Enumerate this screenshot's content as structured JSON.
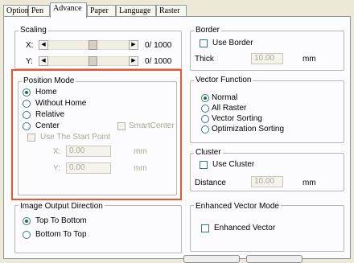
{
  "tabs": [
    "Option",
    "Pen",
    "Advance",
    "Paper",
    "Language",
    "Raster"
  ],
  "active_tab": "Advance",
  "scaling": {
    "title": "Scaling",
    "x_label": "X:",
    "y_label": "Y:",
    "x_value": "0/ 1000",
    "y_value": "0/ 1000"
  },
  "position_mode": {
    "title": "Position Mode",
    "options": [
      "Home",
      "Without Home",
      "Relative",
      "Center"
    ],
    "selected": "Home",
    "smart_center": "SmartCenter",
    "use_start_point": "Use The Start Point",
    "x_label": "X:",
    "y_label": "Y:",
    "x_value": "0.00",
    "y_value": "0.00",
    "unit": "mm"
  },
  "image_output": {
    "title": "Image Output Direction",
    "options": [
      "Top To Bottom",
      "Bottom To Top"
    ],
    "selected": "Top To Bottom"
  },
  "border": {
    "title": "Border",
    "use_border": "Use Border",
    "thick_label": "Thick",
    "thick_value": "10.00",
    "unit": "mm"
  },
  "vector_function": {
    "title": "Vector Function",
    "options": [
      "Normal",
      "All Raster",
      "Vector Sorting",
      "Optimization Sorting"
    ],
    "selected": "Normal"
  },
  "cluster": {
    "title": "Cluster",
    "use_cluster": "Use Cluster",
    "distance_label": "Distance",
    "distance_value": "10.00",
    "unit": "mm"
  },
  "enhanced": {
    "title": "Enhanced Vector Mode",
    "label": "Enhanced Vector"
  },
  "colors": {
    "highlight": "#e8562b",
    "window": "#ece9d8",
    "panel": "#fcfcfe"
  }
}
